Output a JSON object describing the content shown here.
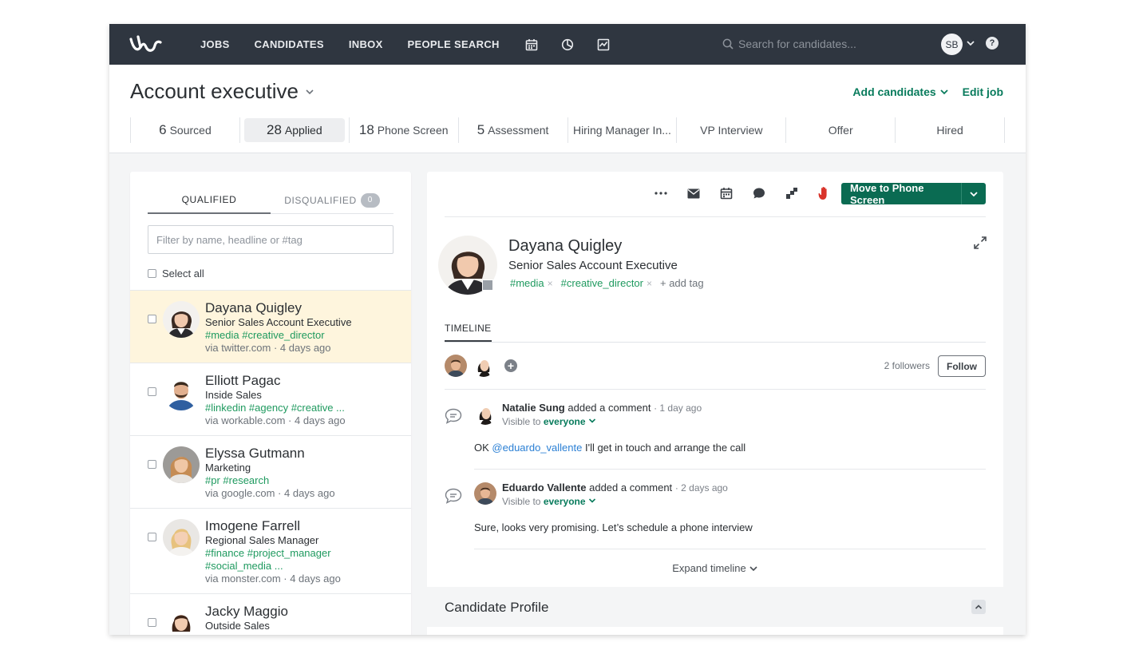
{
  "nav": {
    "links": [
      "JOBS",
      "CANDIDATES",
      "INBOX",
      "PEOPLE SEARCH"
    ],
    "search_placeholder": "Search for candidates...",
    "user_initials": "SB",
    "help": "?"
  },
  "job": {
    "title": "Account executive",
    "add_candidates": "Add candidates",
    "edit_job": "Edit job",
    "stages": [
      {
        "count": "6",
        "label": "Sourced"
      },
      {
        "count": "28",
        "label": "Applied"
      },
      {
        "count": "18",
        "label": "Phone Screen"
      },
      {
        "count": "5",
        "label": "Assessment"
      },
      {
        "count": "",
        "label": "Hiring Manager In..."
      },
      {
        "count": "",
        "label": "VP Interview"
      },
      {
        "count": "",
        "label": "Offer"
      },
      {
        "count": "",
        "label": "Hired"
      }
    ]
  },
  "left": {
    "tab_qualified": "QUALIFIED",
    "tab_disqualified": "DISQUALIFIED",
    "disqualified_count": "0",
    "filter_placeholder": "Filter by name, headline or #tag",
    "select_all": "Select all",
    "candidates": [
      {
        "name": "Dayana Quigley",
        "headline": "Senior Sales Account Executive",
        "tags": "#media #creative_director",
        "tags2": "",
        "source": "via twitter.com · 4 days ago"
      },
      {
        "name": "Elliott Pagac",
        "headline": "Inside Sales",
        "tags": "#linkedin #agency #creative ...",
        "tags2": "",
        "source": "via workable.com · 4 days ago"
      },
      {
        "name": "Elyssa Gutmann",
        "headline": "Marketing",
        "tags": "#pr #research",
        "tags2": "",
        "source": "via google.com · 4 days ago"
      },
      {
        "name": "Imogene Farrell",
        "headline": "Regional Sales Manager",
        "tags": "#finance #project_manager",
        "tags2": "#social_media ...",
        "source": "via monster.com · 4 days ago"
      },
      {
        "name": "Jacky Maggio",
        "headline": "Outside Sales",
        "tags": "",
        "tags2": "",
        "source": ""
      }
    ]
  },
  "right": {
    "move_button": "Move to Phone Screen",
    "name": "Dayana Quigley",
    "headline": "Senior Sales Account Executive",
    "tags": [
      "#media",
      "#creative_director"
    ],
    "add_tag": "+ add tag",
    "timeline_tab": "TIMELINE",
    "followers_count": "2 followers",
    "follow": "Follow",
    "comments": [
      {
        "author": "Natalie Sung",
        "action": "added a comment",
        "ago": "· 1 day ago",
        "visible_prefix": "Visible to",
        "visible_to": "everyone",
        "body_pre": "OK ",
        "mention": "@eduardo_vallente",
        "body_post": " I'll get in touch and arrange the call"
      },
      {
        "author": "Eduardo Vallente",
        "action": "added a comment",
        "ago": "· 2 days ago",
        "visible_prefix": "Visible to",
        "visible_to": "everyone",
        "body_pre": "Sure, looks very promising. Let’s schedule a phone interview",
        "mention": "",
        "body_post": ""
      }
    ],
    "expand_timeline": "Expand timeline",
    "candidate_profile": "Candidate Profile"
  },
  "colors": {
    "nav_bg": "#2f3640",
    "accent_green": "#087b5c",
    "tag_green": "#1f9a5f",
    "selected_row": "#fef5dd",
    "mention_blue": "#2a7fd4",
    "disqualify_red": "#d9342b"
  },
  "icons": {
    "logo": "workable-logo",
    "nav": [
      "calendar-icon",
      "pie-chart-icon",
      "reports-icon"
    ],
    "toolbar": [
      "more-icon",
      "email-icon",
      "calendar-icon",
      "comment-icon",
      "evaluate-icon",
      "disqualify-hand-icon"
    ]
  }
}
